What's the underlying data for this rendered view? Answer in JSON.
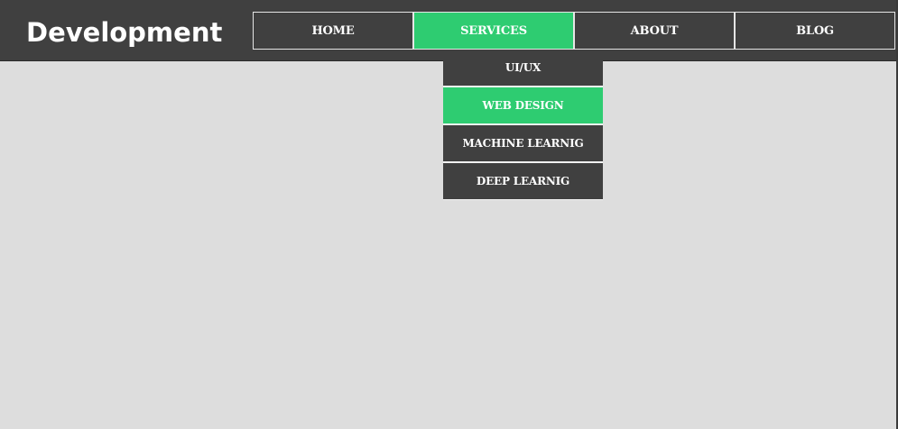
{
  "header": {
    "logo_text": "Development"
  },
  "nav": {
    "items": [
      {
        "label": "HOME",
        "active": false
      },
      {
        "label": "SERVICES",
        "active": true
      },
      {
        "label": "ABOUT",
        "active": false
      },
      {
        "label": "BLOG",
        "active": false
      }
    ]
  },
  "dropdown": {
    "items": [
      {
        "label": "UI/UX",
        "active": false
      },
      {
        "label": "WEB DESIGN",
        "active": true
      },
      {
        "label": "MACHINE LEARNIG",
        "active": false
      },
      {
        "label": "DEEP LEARNIG",
        "active": false
      }
    ]
  },
  "colors": {
    "header_bg": "#404040",
    "accent": "#2ecc71",
    "page_bg": "#dddddd"
  }
}
